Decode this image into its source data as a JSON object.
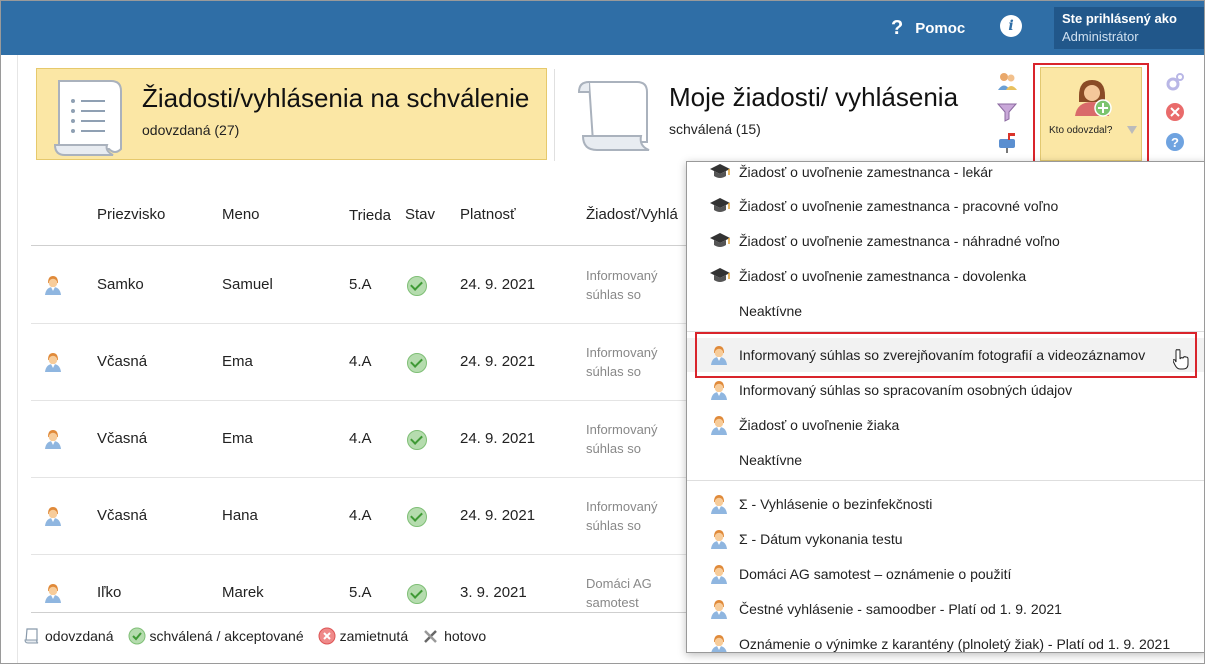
{
  "header": {
    "help_label": "Pomoc",
    "info_icon": "i",
    "user_label": "Ste prihlásený ako",
    "user_role": "Administrátor"
  },
  "tiles": {
    "active": {
      "title": "Žiadosti/vyhlásenia na schválenie",
      "subtitle": "odovzdaná (27)"
    },
    "mine": {
      "title": "Moje žiadosti/ vyhlásenia",
      "subtitle": "schválená (15)"
    }
  },
  "who_button": {
    "label": "Kto odovzdal?"
  },
  "table": {
    "headers": [
      "Priezvisko",
      "Meno",
      "Trieda",
      "Stav",
      "Platnosť",
      "Žiadosť/Vyhlá"
    ],
    "rows": [
      {
        "surname": "Samko",
        "name": "Samuel",
        "class": "5.A",
        "valid": "24. 9. 2021",
        "request": "Informovaný súhlas so zverejňovaním fotografií a videozáznamov"
      },
      {
        "surname": "Včasná",
        "name": "Ema",
        "class": "4.A",
        "valid": "24. 9. 2021",
        "request": "Informovaný súhlas so spracovaním osobných údajov"
      },
      {
        "surname": "Včasná",
        "name": "Ema",
        "class": "4.A",
        "valid": "24. 9. 2021",
        "request": "Informovaný súhlas so zverejňovaním fotografií a videozáznamov"
      },
      {
        "surname": "Včasná",
        "name": "Hana",
        "class": "4.A",
        "valid": "24. 9. 2021",
        "request": "Informovaný súhlas so zverejňovaním fotografií a videozáznamov"
      },
      {
        "surname": "Iľko",
        "name": "Marek",
        "class": "5.A",
        "valid": "3. 9. 2021",
        "request": "Domáci AG samotest"
      }
    ]
  },
  "legend": {
    "submitted": "odovzdaná",
    "approved": "schválená / akceptované",
    "rejected": "zamietnutá",
    "done": "hotovo"
  },
  "dropdown": {
    "items": [
      {
        "icon": "graduation-cap-icon",
        "label": "Žiadosť o uvoľnenie zamestnanca - lekár"
      },
      {
        "icon": "graduation-cap-icon",
        "label": "Žiadosť o uvoľnenie zamestnanca - pracovné voľno"
      },
      {
        "icon": "graduation-cap-icon",
        "label": "Žiadosť o uvoľnenie zamestnanca - náhradné voľno"
      },
      {
        "icon": "graduation-cap-icon",
        "label": "Žiadosť o uvoľnenie zamestnanca - dovolenka"
      },
      {
        "icon": "",
        "label": "Neaktívne"
      },
      {
        "icon": "student-icon",
        "label": "Informovaný súhlas so zverejňovaním fotografií a videozáznamov"
      },
      {
        "icon": "student-icon",
        "label": "Informovaný súhlas so spracovaním osobných údajov"
      },
      {
        "icon": "student-icon",
        "label": "Žiadosť o uvoľnenie žiaka"
      },
      {
        "icon": "",
        "label": "Neaktívne"
      },
      {
        "icon": "student-icon",
        "label": "Σ - Vyhlásenie o bezinfekčnosti"
      },
      {
        "icon": "student-icon",
        "label": "Σ - Dátum vykonania testu"
      },
      {
        "icon": "student-icon",
        "label": "Domáci AG samotest – oznámenie o použití"
      },
      {
        "icon": "student-icon",
        "label": "Čestné vyhlásenie - samoodber - Platí od 1. 9. 2021"
      },
      {
        "icon": "student-icon",
        "label": "Oznámenie o výnimke z karantény (plnoletý žiak) - Platí od 1. 9. 2021"
      }
    ]
  },
  "colors": {
    "topbar": "#2f6ea6",
    "active_tile": "#fbe7a5",
    "highlight": "#d9242b"
  }
}
